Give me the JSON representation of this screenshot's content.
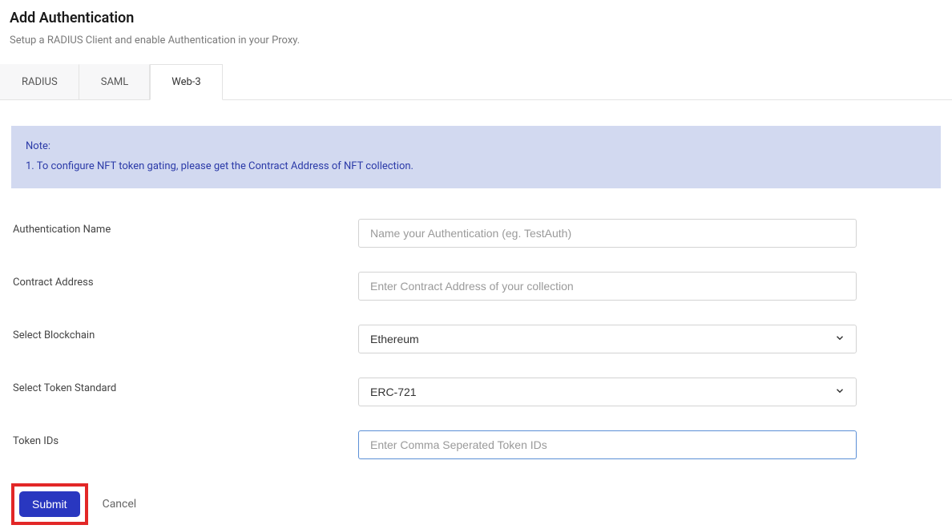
{
  "header": {
    "title": "Add Authentication",
    "subtitle": "Setup a RADIUS Client and enable Authentication in your Proxy."
  },
  "tabs": [
    {
      "label": "RADIUS",
      "active": false
    },
    {
      "label": "SAML",
      "active": false
    },
    {
      "label": "Web-3",
      "active": true
    }
  ],
  "note": {
    "label": "Note:",
    "line1": "1. To configure NFT token gating, please get the Contract Address of NFT collection."
  },
  "form": {
    "auth_name": {
      "label": "Authentication Name",
      "placeholder": "Name your Authentication (eg. TestAuth)",
      "value": ""
    },
    "contract_address": {
      "label": "Contract Address",
      "placeholder": "Enter Contract Address of your collection",
      "value": ""
    },
    "blockchain": {
      "label": "Select Blockchain",
      "selected": "Ethereum"
    },
    "token_standard": {
      "label": "Select Token Standard",
      "selected": "ERC-721"
    },
    "token_ids": {
      "label": "Token IDs",
      "placeholder": "Enter Comma Seperated Token IDs",
      "value": ""
    }
  },
  "actions": {
    "submit": "Submit",
    "cancel": "Cancel"
  }
}
